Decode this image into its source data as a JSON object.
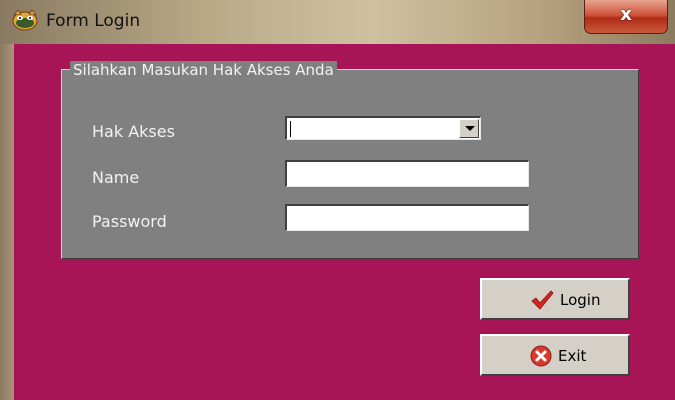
{
  "window": {
    "title": "Form Login",
    "close_label": "x"
  },
  "form": {
    "group_title": "Silahkan Masukan Hak Akses Anda",
    "fields": [
      {
        "label": "Hak Akses",
        "value": "",
        "type": "dropdown"
      },
      {
        "label": "Name",
        "value": "",
        "type": "text"
      },
      {
        "label": "Password",
        "value": "",
        "type": "password"
      }
    ]
  },
  "buttons": {
    "login_label": "Login",
    "exit_label": "Exit"
  },
  "icons": {
    "app": "cat-face-icon",
    "login": "checkmark-icon",
    "exit": "red-x-circle-icon"
  },
  "colors": {
    "client_bg": "#a71556",
    "group_bg": "#808080",
    "button_bg": "#d4d0c8",
    "check": "#d8261c",
    "exit_icon": "#d93a2e"
  }
}
